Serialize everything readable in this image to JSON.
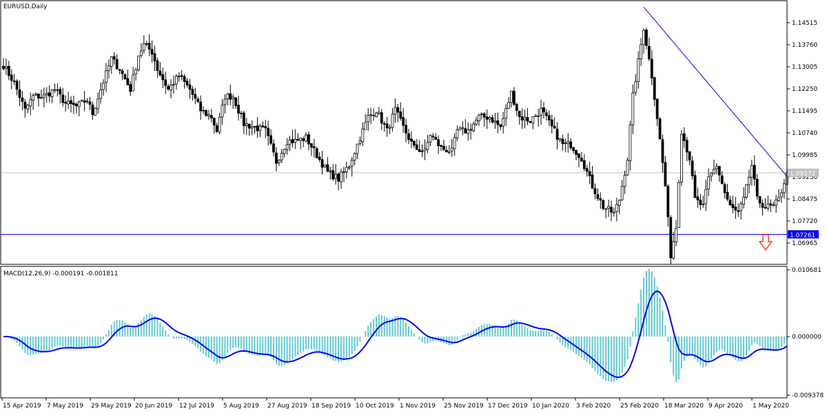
{
  "header": {
    "symbol_title": "EURUSD,Daily"
  },
  "macd_title": "MACD(12,26,9) -0.000191 -0.001811",
  "colors": {
    "trendline": "#0000ff",
    "histogram": "#5ccbd8",
    "signal": "#0000ff",
    "bid_line": "#c0c0c0",
    "level_tag": "#0000ff",
    "arrow": "#ff2000"
  },
  "chart_data": [
    {
      "type": "candlestick",
      "title": "EURUSD,Daily",
      "price_ticks": [
        "1.14515",
        "1.13760",
        "1.13005",
        "1.12250",
        "1.11495",
        "1.10740",
        "1.09985",
        "1.09230",
        "1.08475",
        "1.07720",
        "1.06965"
      ],
      "ylim": [
        1.062,
        1.153
      ],
      "bar_count": 291,
      "close_anchors": [
        [
          0,
          1.1305
        ],
        [
          4,
          1.1246
        ],
        [
          8,
          1.1152
        ],
        [
          11,
          1.1199
        ],
        [
          15,
          1.1199
        ],
        [
          19,
          1.1223
        ],
        [
          23,
          1.1175
        ],
        [
          27,
          1.1164
        ],
        [
          31,
          1.1187
        ],
        [
          33,
          1.114
        ],
        [
          36,
          1.1223
        ],
        [
          40,
          1.1329
        ],
        [
          43,
          1.1293
        ],
        [
          47,
          1.1223
        ],
        [
          50,
          1.1341
        ],
        [
          52,
          1.1376
        ],
        [
          55,
          1.1352
        ],
        [
          57,
          1.1293
        ],
        [
          61,
          1.1223
        ],
        [
          65,
          1.127
        ],
        [
          69,
          1.1223
        ],
        [
          73,
          1.1152
        ],
        [
          77,
          1.1128
        ],
        [
          79,
          1.1081
        ],
        [
          82,
          1.1199
        ],
        [
          85,
          1.1199
        ],
        [
          89,
          1.1105
        ],
        [
          93,
          1.1093
        ],
        [
          97,
          1.1081
        ],
        [
          101,
          1.0975
        ],
        [
          105,
          1.1046
        ],
        [
          108,
          1.1046
        ],
        [
          112,
          1.1057
        ],
        [
          116,
          1.0998
        ],
        [
          120,
          1.0939
        ],
        [
          124,
          1.0916
        ],
        [
          128,
          1.0963
        ],
        [
          131,
          1.1034
        ],
        [
          135,
          1.1128
        ],
        [
          138,
          1.1152
        ],
        [
          142,
          1.1081
        ],
        [
          145,
          1.1152
        ],
        [
          148,
          1.1093
        ],
        [
          152,
          1.1022
        ],
        [
          156,
          1.101
        ],
        [
          158,
          1.1069
        ],
        [
          162,
          1.1022
        ],
        [
          166,
          1.101
        ],
        [
          168,
          1.1081
        ],
        [
          172,
          1.1081
        ],
        [
          176,
          1.1128
        ],
        [
          180,
          1.1128
        ],
        [
          184,
          1.1093
        ],
        [
          188,
          1.1211
        ],
        [
          191,
          1.1128
        ],
        [
          195,
          1.1116
        ],
        [
          199,
          1.1152
        ],
        [
          203,
          1.1093
        ],
        [
          207,
          1.1034
        ],
        [
          210,
          1.1034
        ],
        [
          214,
          1.0987
        ],
        [
          218,
          1.0892
        ],
        [
          222,
          1.0821
        ],
        [
          226,
          1.0798
        ],
        [
          228,
          1.0845
        ],
        [
          231,
          1.0987
        ],
        [
          233,
          1.1199
        ],
        [
          237,
          1.1435
        ],
        [
          240,
          1.127
        ],
        [
          242,
          1.1128
        ],
        [
          245,
          1.0892
        ],
        [
          247,
          1.0656
        ],
        [
          249,
          1.0751
        ],
        [
          251,
          1.1081
        ],
        [
          254,
          1.0987
        ],
        [
          256,
          1.0845
        ],
        [
          259,
          1.0821
        ],
        [
          261,
          1.0916
        ],
        [
          264,
          1.0963
        ],
        [
          267,
          1.0869
        ],
        [
          269,
          1.0821
        ],
        [
          272,
          1.0798
        ],
        [
          274,
          1.0845
        ],
        [
          277,
          1.0963
        ],
        [
          279,
          1.0845
        ],
        [
          282,
          1.0821
        ],
        [
          285,
          1.0821
        ],
        [
          287,
          1.0845
        ],
        [
          290,
          1.09372
        ]
      ],
      "bid_price": "1.09372",
      "horizontal_level": "1.07261",
      "trendline": {
        "from": [
          237,
          1.1505
        ],
        "to": [
          290,
          1.0925
        ]
      },
      "arrow_signal": "down"
    },
    {
      "type": "macd",
      "title": "MACD(12,26,9) -0.000191 -0.001811",
      "params": [
        12,
        26,
        9
      ],
      "ticks": [
        "0.010681",
        "0.000000",
        "-0.009378"
      ],
      "ylim": [
        -0.009378,
        0.010681
      ]
    }
  ],
  "x_axis_labels": [
    "15 Apr 2019",
    "7 May 2019",
    "29 May 2019",
    "20 Jun 2019",
    "12 Jul 2019",
    "5 Aug 2019",
    "27 Aug 2019",
    "18 Sep 2019",
    "10 Oct 2019",
    "1 Nov 2019",
    "25 Nov 2019",
    "17 Dec 2019",
    "10 Jan 2020",
    "3 Feb 2020",
    "25 Feb 2020",
    "18 Mar 2020",
    "9 Apr 2020",
    "1 May 2020"
  ]
}
